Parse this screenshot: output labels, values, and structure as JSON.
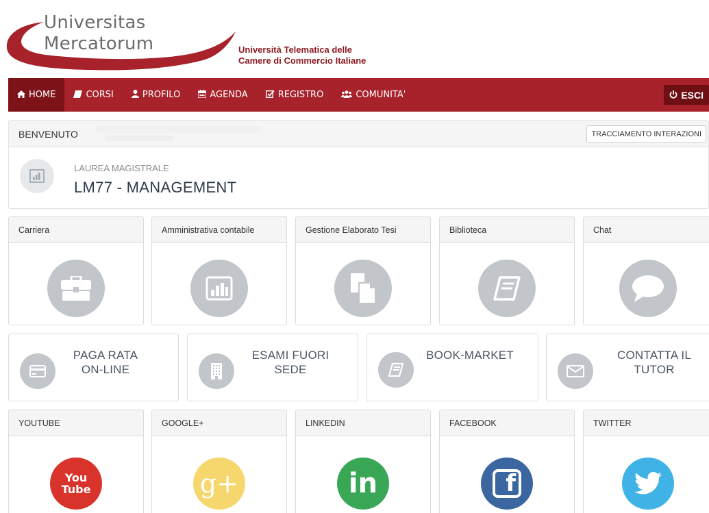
{
  "brand": {
    "logo_line1": "Universitas",
    "logo_line2": "Mercatorum",
    "tagline_line1": "Università Telematica delle",
    "tagline_line2": "Camere di Commercio Italiane",
    "accent": "#a7222a"
  },
  "nav": {
    "items": [
      {
        "label": "HOME",
        "icon": "home-icon"
      },
      {
        "label": "CORSI",
        "icon": "book-icon"
      },
      {
        "label": "PROFILO",
        "icon": "user-icon"
      },
      {
        "label": "AGENDA",
        "icon": "calendar-icon"
      },
      {
        "label": "REGISTRO",
        "icon": "checkbox-icon"
      },
      {
        "label": "COMUNITA'",
        "icon": "users-icon"
      }
    ],
    "logout_label": "ESCI"
  },
  "welcome": {
    "title": "BENVENUTO",
    "tracking_button": "TRACCIAMENTO INTERAZIONI",
    "degree_type": "LAUREA MAGISTRALE",
    "degree_name": "LM77 - MANAGEMENT"
  },
  "services": [
    {
      "label": "Carriera",
      "icon": "briefcase-icon"
    },
    {
      "label": "Amministrativa contabile",
      "icon": "bar-chart-icon"
    },
    {
      "label": "Gestione Elaborato Tesi",
      "icon": "documents-icon"
    },
    {
      "label": "Biblioteca",
      "icon": "book-icon"
    },
    {
      "label": "Chat",
      "icon": "chat-bubble-icon"
    }
  ],
  "actions": [
    {
      "line1": "PAGA RATA",
      "line2": "ON-LINE",
      "icon": "credit-card-icon"
    },
    {
      "line1": "ESAMI FUORI",
      "line2": "SEDE",
      "icon": "building-icon"
    },
    {
      "line1": "BOOK-MARKET",
      "line2": "",
      "icon": "book-icon"
    },
    {
      "line1": "CONTATTA IL",
      "line2": "TUTOR",
      "icon": "envelope-icon"
    }
  ],
  "social": [
    {
      "label": "YOUTUBE",
      "icon": "youtube-icon",
      "color": "#d9342b",
      "glyph1": "You",
      "glyph2": "Tube"
    },
    {
      "label": "GOOGLE+",
      "icon": "google-plus-icon",
      "color": "#f5d76e",
      "glyph1": "g+"
    },
    {
      "label": "LINKEDIN",
      "icon": "linkedin-icon",
      "color": "#3aa757",
      "glyph1": "in"
    },
    {
      "label": "FACEBOOK",
      "icon": "facebook-icon",
      "color": "#3b66a0",
      "glyph1": "f"
    },
    {
      "label": "TWITTER",
      "icon": "twitter-icon",
      "color": "#3fb3e5"
    }
  ]
}
